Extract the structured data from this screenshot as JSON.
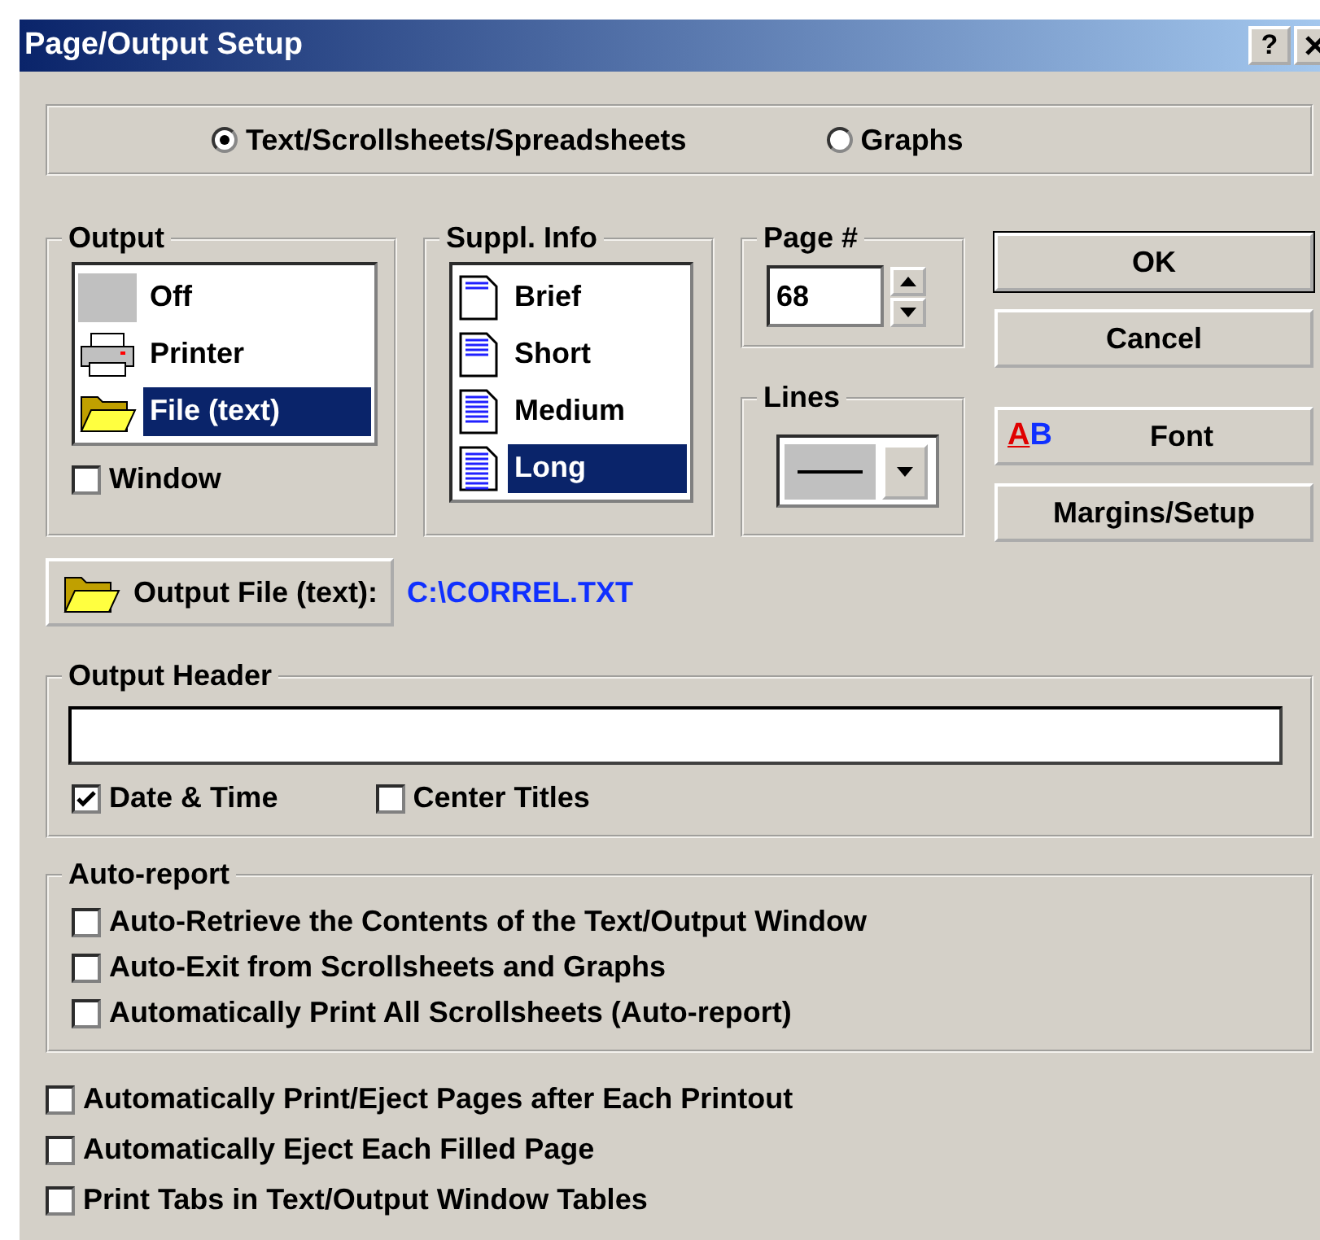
{
  "window": {
    "title": "Page/Output Setup",
    "help": "?"
  },
  "mode": [
    {
      "label": "Text/Scrollsheets/Spreadsheets",
      "selected": true
    },
    {
      "label": "Graphs",
      "selected": false
    }
  ],
  "output": {
    "title": "Output",
    "items": [
      {
        "label": "Off",
        "kind": "blank",
        "selected": false
      },
      {
        "label": "Printer",
        "kind": "printer",
        "selected": false
      },
      {
        "label": "File (text)",
        "kind": "folder",
        "selected": true
      }
    ],
    "window_option": {
      "label": "Window",
      "checked": false
    }
  },
  "suppl_info": {
    "title": "Suppl. Info",
    "items": [
      {
        "label": "Brief",
        "selected": false
      },
      {
        "label": "Short",
        "selected": false
      },
      {
        "label": "Medium",
        "selected": false
      },
      {
        "label": "Long",
        "selected": true
      }
    ]
  },
  "page": {
    "title": "Page #",
    "value": "68"
  },
  "lines": {
    "title": "Lines"
  },
  "buttons": [
    {
      "label": "OK",
      "kind": "default"
    },
    {
      "label": "Cancel",
      "kind": "plain"
    },
    {
      "label": "Font",
      "kind": "font",
      "icon_text": "AB"
    },
    {
      "label": "Margins/Setup",
      "kind": "plain"
    }
  ],
  "output_file": {
    "button": "Output File (text):",
    "path": "C:\\CORREL.TXT"
  },
  "output_header": {
    "title": "Output Header",
    "options": [
      {
        "label": "Date & Time",
        "checked": true
      },
      {
        "label": "Center Titles",
        "checked": false
      }
    ]
  },
  "auto_report": {
    "title": "Auto-report",
    "options": [
      {
        "label": "Auto-Retrieve the Contents of the Text/Output Window",
        "checked": false
      },
      {
        "label": "Auto-Exit from Scrollsheets and Graphs",
        "checked": false
      },
      {
        "label": "Automatically Print All Scrollsheets (Auto-report)",
        "checked": false
      }
    ]
  },
  "options": [
    {
      "label": "Automatically Print/Eject Pages after Each Printout",
      "checked": false
    },
    {
      "label": "Automatically Eject Each Filled Page",
      "checked": false
    },
    {
      "label": "Print Tabs in Text/Output Window Tables",
      "checked": false
    }
  ]
}
